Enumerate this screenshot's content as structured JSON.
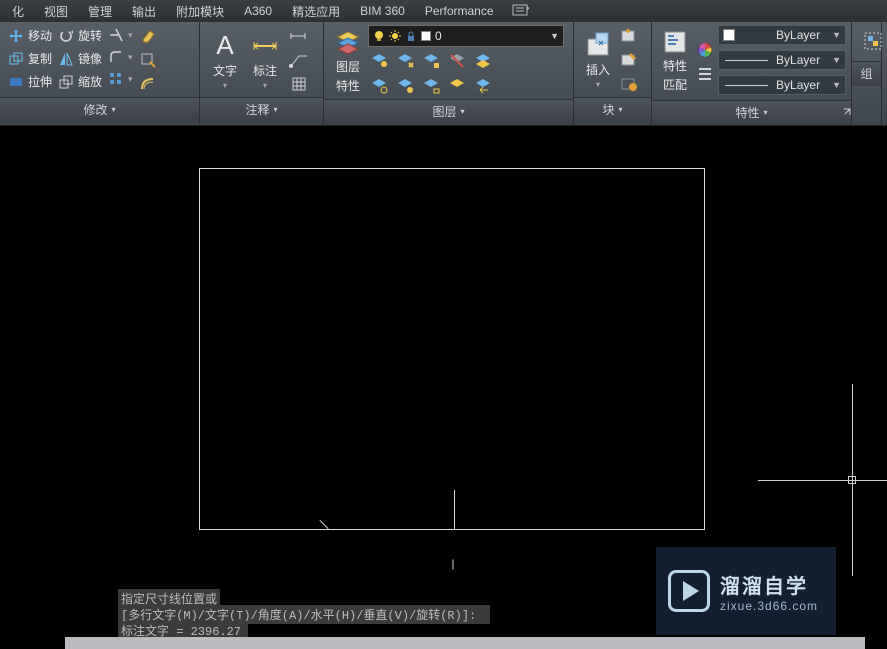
{
  "menu": {
    "items": [
      "化",
      "视图",
      "管理",
      "输出",
      "附加模块",
      "A360",
      "精选应用",
      "BIM 360",
      "Performance"
    ]
  },
  "ribbon": {
    "modify": {
      "title": "修改",
      "move": "移动",
      "rotate": "旋转",
      "copy": "复制",
      "mirror": "镜像",
      "stretch": "拉伸",
      "scale": "缩放"
    },
    "annotate": {
      "title": "注释",
      "text": "文字",
      "dim": "标注"
    },
    "layers": {
      "title": "图层",
      "layer": "图层",
      "props": "特性",
      "current_layer": "0"
    },
    "block": {
      "title": "块",
      "insert": "插入"
    },
    "properties": {
      "title": "特性",
      "propbtn": "特性",
      "match": "匹配",
      "bylayer": "ByLayer"
    },
    "group": {
      "title": "组"
    }
  },
  "cmd": {
    "l1": "指定尺寸线位置或",
    "l2": "[多行文字(M)/文字(T)/角度(A)/水平(H)/垂直(V)/旋转(R)]:",
    "l3": "标注文字 = 2396.27"
  },
  "watermark": {
    "l1": "溜溜自学",
    "l2": "zixue.3d66.com"
  }
}
